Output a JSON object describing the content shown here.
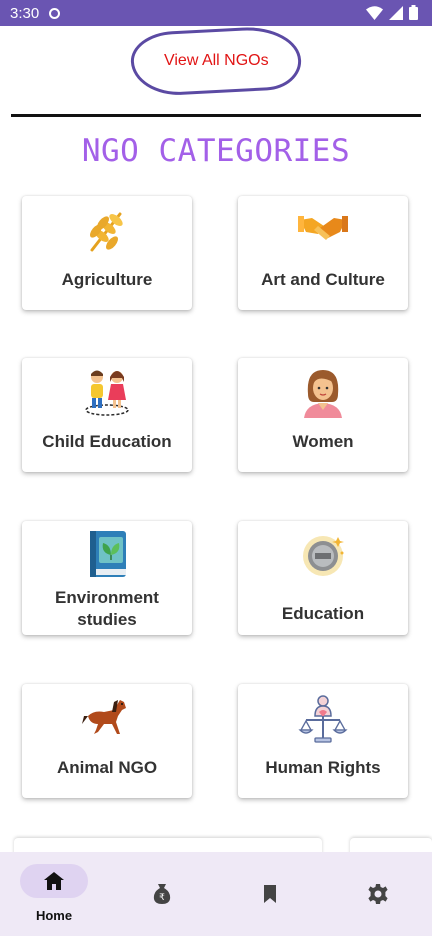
{
  "status": {
    "time": "3:30"
  },
  "header": {
    "view_all_label": "View All NGOs"
  },
  "section": {
    "title": "NGO CATEGORIES"
  },
  "categories": [
    {
      "label": "Agriculture",
      "icon": "wheat-icon"
    },
    {
      "label": "Art and Culture",
      "icon": "handshake-icon"
    },
    {
      "label": "Child Education",
      "icon": "children-icon"
    },
    {
      "label": "Women",
      "icon": "woman-icon"
    },
    {
      "label": "Environment studies",
      "icon": "leaf-book-icon"
    },
    {
      "label": "Education",
      "icon": "coin-icon"
    },
    {
      "label": "Animal NGO",
      "icon": "horse-icon"
    },
    {
      "label": "Human Rights",
      "icon": "justice-scale-icon"
    }
  ],
  "nav": {
    "items": [
      {
        "label": "Home",
        "icon": "home-icon",
        "active": true
      },
      {
        "label": "",
        "icon": "donation-bag-icon"
      },
      {
        "label": "",
        "icon": "bookmark-icon"
      },
      {
        "label": "",
        "icon": "gear-icon"
      }
    ]
  },
  "colors": {
    "accent": "#a360e8",
    "status_bar": "#6a55b2",
    "link_red": "#e11414",
    "nav_bg": "#efe9f6"
  }
}
